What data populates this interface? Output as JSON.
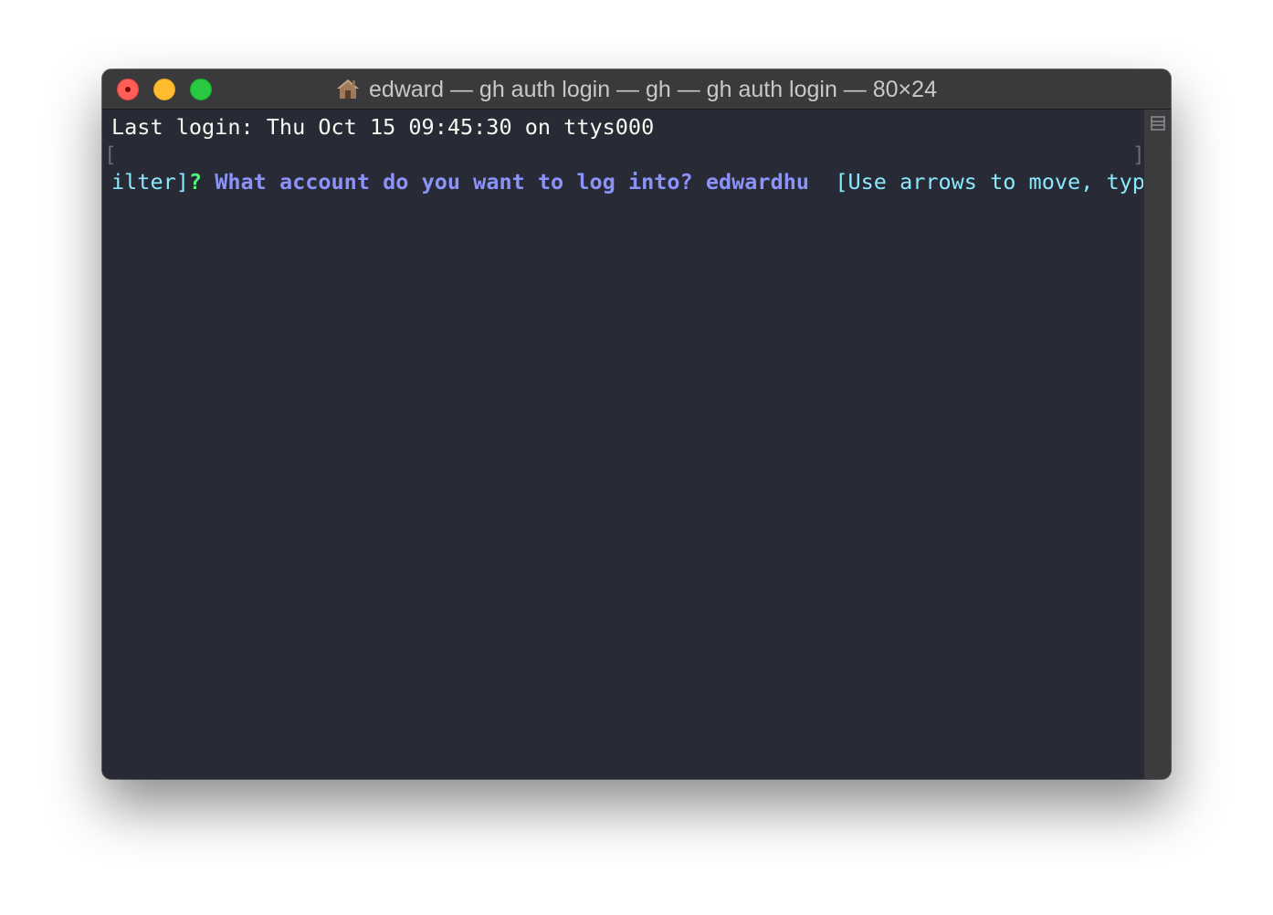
{
  "window": {
    "title": "edward — gh auth login — gh — gh auth login — 80×24",
    "title_icon": "home-folder-icon",
    "traffic_lights": [
      "close",
      "minimize",
      "zoom"
    ]
  },
  "terminal": {
    "line1": "Last login: Thu Oct 15 09:45:30 on ttys000",
    "line2": {
      "prompt_mark": "?",
      "question": "What account do you want to log into?",
      "answer": "edwardhu",
      "hint": "[Use arrows to move, type to f",
      "hint_wrap": "ilter]",
      "left_mark": "[",
      "right_mark": "]"
    }
  },
  "colors": {
    "background": "#282a36",
    "titlebar": "#3a3a3c",
    "prompt_green": "#50fa7b",
    "question_purple": "#8b93f8",
    "hint_cyan": "#8be9fd"
  }
}
